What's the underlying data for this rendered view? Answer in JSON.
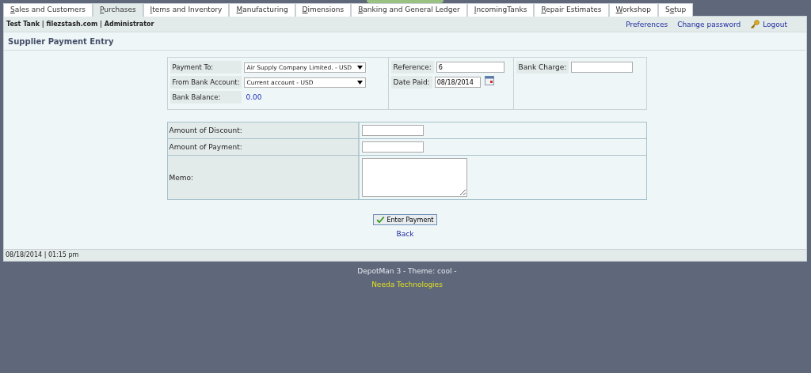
{
  "tabs": [
    {
      "key": "S",
      "post": "ales and Customers",
      "selected": false
    },
    {
      "key": "P",
      "post": "urchases",
      "selected": true
    },
    {
      "key": "I",
      "post": "tems and Inventory",
      "selected": false
    },
    {
      "key": "M",
      "post": "anufacturing",
      "selected": false
    },
    {
      "key": "D",
      "post": "imensions",
      "selected": false
    },
    {
      "key": "B",
      "post": "anking and General Ledger",
      "selected": false
    },
    {
      "key": "I",
      "post": "ncomingTanks",
      "selected": false
    },
    {
      "key": "R",
      "post": "epair Estimates",
      "selected": false
    },
    {
      "key": "W",
      "post": "orkshop",
      "selected": false
    },
    {
      "pre": "S",
      "key": "e",
      "post": "tup",
      "selected": false
    }
  ],
  "header": {
    "company": "Test Tank | filezstash.com | Administrator",
    "links": [
      "Preferences",
      "Change password"
    ],
    "logout": "Logout"
  },
  "page_title": "Supplier Payment Entry",
  "form": {
    "payment_to": {
      "label": "Payment To:",
      "value": "Air Supply Company Limited. - USD"
    },
    "bank_account": {
      "label": "From Bank Account:",
      "value": "Current account - USD"
    },
    "bank_balance": {
      "label": "Bank Balance:",
      "value": "0.00"
    },
    "reference": {
      "label": "Reference:",
      "value": "6"
    },
    "date_paid": {
      "label": "Date Paid:",
      "value": "08/18/2014"
    },
    "bank_charge": {
      "label": "Bank Charge:"
    }
  },
  "amounts": [
    {
      "kind": "input",
      "label": "Amount of Discount:"
    },
    {
      "kind": "input",
      "label": "Amount of Payment:"
    },
    {
      "kind": "textarea",
      "label": "Memo:"
    }
  ],
  "submit": "Enter Payment",
  "back": "Back",
  "status_bar": "08/18/2014 | 01:15 pm",
  "footer": {
    "theme": "DepotMan 3 - Theme: cool -",
    "company": "Needa Technologies"
  }
}
